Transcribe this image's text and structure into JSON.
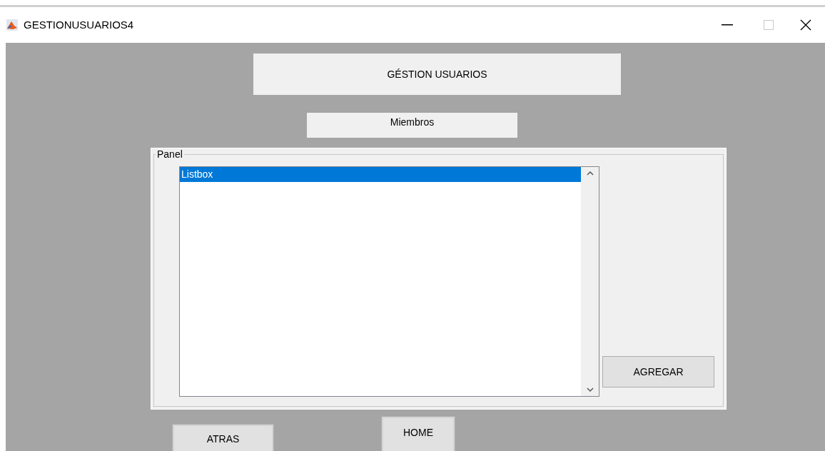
{
  "window": {
    "title": "GESTIONUSUARIOS4"
  },
  "heading": "GÉSTION USUARIOS",
  "subheading": "Miembros",
  "panel": {
    "title": "Panel",
    "listbox": {
      "items": [
        {
          "text": "Listbox",
          "selected": true
        }
      ]
    },
    "add_button": "AGREGAR"
  },
  "buttons": {
    "back": "ATRAS",
    "home": "HOME"
  }
}
